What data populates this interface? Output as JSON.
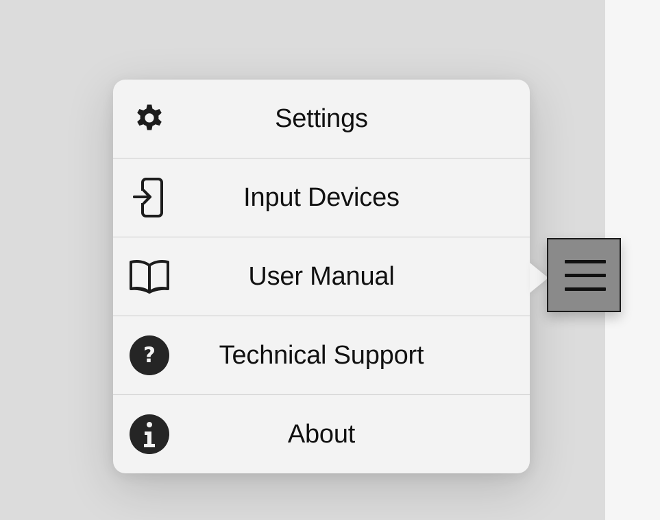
{
  "menu": {
    "items": [
      {
        "label": "Settings",
        "icon": "gear-icon"
      },
      {
        "label": "Input Devices",
        "icon": "input-devices-icon"
      },
      {
        "label": "User Manual",
        "icon": "book-icon"
      },
      {
        "label": "Technical Support",
        "icon": "question-circle-icon"
      },
      {
        "label": "About",
        "icon": "info-circle-icon"
      }
    ]
  },
  "menu_button": {
    "icon": "hamburger-menu-icon"
  },
  "colors": {
    "background": "#dcdcdc",
    "popover": "#f3f3f3",
    "divider": "#c9c9c9",
    "icon": "#1c1c1c",
    "text": "#111111",
    "menu_button": "#8a8a8a"
  }
}
